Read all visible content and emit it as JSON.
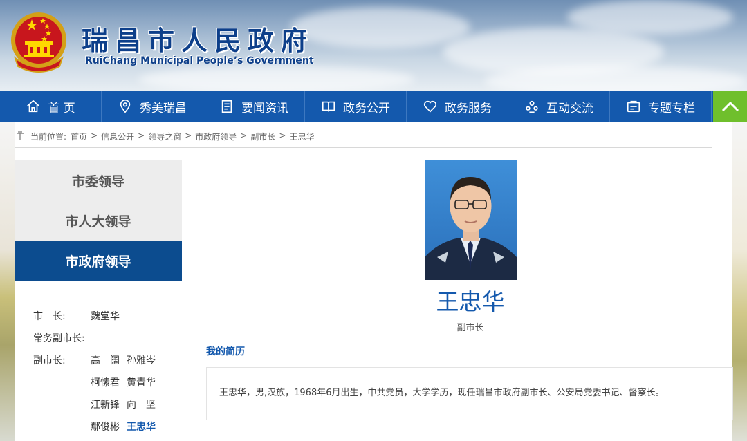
{
  "header": {
    "title": "瑞昌市人民政府",
    "subtitle": "RuiChang Municipal People’s Government"
  },
  "nav": {
    "items": [
      {
        "label": "首 页",
        "icon": "home-icon"
      },
      {
        "label": "秀美瑞昌",
        "icon": "location-pin-icon"
      },
      {
        "label": "要闻资讯",
        "icon": "document-icon"
      },
      {
        "label": "政务公开",
        "icon": "book-icon"
      },
      {
        "label": "政务服务",
        "icon": "heart-icon"
      },
      {
        "label": "互动交流",
        "icon": "people-icon"
      },
      {
        "label": "专题专栏",
        "icon": "tray-icon"
      }
    ],
    "up_icon": "chevron-up-icon"
  },
  "breadcrumb": {
    "prefix": "当前位置:",
    "items": [
      "首页",
      "信息公开",
      "领导之窗",
      "市政府领导",
      "副市长",
      "王忠华"
    ],
    "separator": ">"
  },
  "leftmenu": {
    "items": [
      "市委领导",
      "市人大领导",
      "市政府领导"
    ],
    "active_index": 2
  },
  "leaders": {
    "mayor_label": "市　长:",
    "mayor": "魏堂华",
    "exec_label": "常务副市长:",
    "vice_label": "副市长:",
    "vice": [
      "高　阔",
      "孙雅岑",
      "柯愫君",
      "黄青华",
      "汪新锋",
      "向　坚",
      "鄢俊彬",
      "王忠华"
    ]
  },
  "profile": {
    "name": "王忠华",
    "title": "副市长",
    "bio_heading": "我的简历",
    "bio": "王忠华，男,汉族，1968年6月出生，中共党员，大学学历，现任瑞昌市政府副市长、公安局党委书记、督察长。"
  },
  "colors": {
    "nav_bg": "#1459ad",
    "accent_green": "#6fbf2c",
    "menu_active": "#0c4c8f"
  }
}
